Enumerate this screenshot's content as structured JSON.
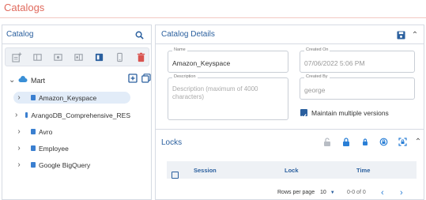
{
  "page": {
    "title": "Catalogs"
  },
  "catalog_panel": {
    "title": "Catalog",
    "toolbar": [
      "add-catalog-icon",
      "columns-icon",
      "eye-icon",
      "eye-right-icon",
      "split-view-icon",
      "device-icon",
      "delete-icon"
    ],
    "tree": {
      "root_label": "Mart",
      "items": [
        {
          "label": "Amazon_Keyspace",
          "selected": true
        },
        {
          "label": "ArangoDB_Comprehensive_RES",
          "selected": false
        },
        {
          "label": "Avro",
          "selected": false
        },
        {
          "label": "Employee",
          "selected": false
        },
        {
          "label": "Google BigQuery",
          "selected": false
        }
      ]
    }
  },
  "details_panel": {
    "title": "Catalog Details",
    "name": {
      "label": "Name",
      "value": "Amazon_Keyspace"
    },
    "created_on": {
      "label": "Created On",
      "value": "07/06/2022 5:06 PM"
    },
    "description": {
      "label": "Description",
      "placeholder": "Description (maximum of 4000 characters)"
    },
    "created_by": {
      "label": "Created By",
      "value": "george"
    },
    "maintain_versions": {
      "label": "Maintain multiple versions",
      "checked": true
    }
  },
  "locks": {
    "title": "Locks",
    "columns": [
      "Session",
      "Lock",
      "Time"
    ],
    "rows_per_page_label": "Rows per page",
    "rows_per_page_value": "10",
    "range_text": "0-0 of 0"
  },
  "colors": {
    "accent": "#2a5f9e",
    "title": "#e06a5d",
    "delete": "#d9534f"
  }
}
